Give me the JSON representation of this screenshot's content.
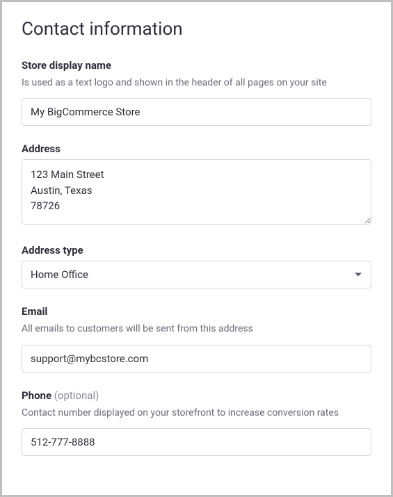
{
  "title": "Contact information",
  "store_display_name": {
    "label": "Store display name",
    "description": "Is used as a text logo and shown in the header of all pages on your site",
    "value": "My BigCommerce Store"
  },
  "address": {
    "label": "Address",
    "value": "123 Main Street\nAustin, Texas\n78726"
  },
  "address_type": {
    "label": "Address type",
    "value": "Home Office"
  },
  "email": {
    "label": "Email",
    "description": "All emails to customers will be sent from this address",
    "value": "support@mybcstore.com"
  },
  "phone": {
    "label": "Phone",
    "optional_text": "(optional)",
    "description": "Contact number displayed on your storefront to increase conversion rates",
    "value": "512-777-8888"
  }
}
